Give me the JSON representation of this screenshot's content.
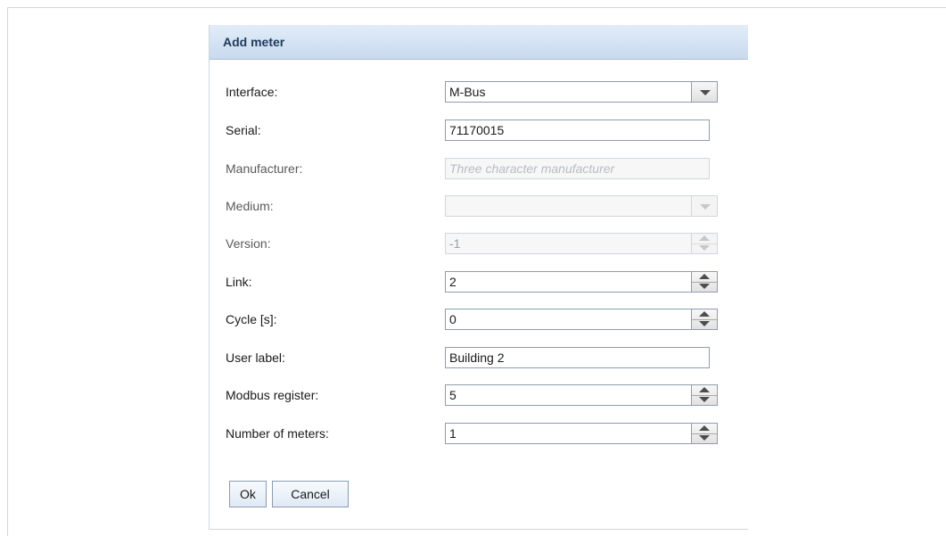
{
  "dialog": {
    "title": "Add meter",
    "fields": {
      "interface": {
        "label": "Interface:",
        "value": "M-Bus"
      },
      "serial": {
        "label": "Serial:",
        "value": "71170015"
      },
      "manufacturer": {
        "label": "Manufacturer:",
        "value": "",
        "placeholder": "Three character manufacturer"
      },
      "medium": {
        "label": "Medium:",
        "value": ""
      },
      "version": {
        "label": "Version:",
        "value": "-1"
      },
      "link": {
        "label": "Link:",
        "value": "2"
      },
      "cycle": {
        "label": "Cycle [s]:",
        "value": "0"
      },
      "user_label": {
        "label": "User label:",
        "value": "Building 2"
      },
      "modbus_register": {
        "label": "Modbus register:",
        "value": "5"
      },
      "number_of_meters": {
        "label": "Number of meters:",
        "value": "1"
      }
    },
    "buttons": {
      "ok": "Ok",
      "cancel": "Cancel"
    }
  },
  "icons": {
    "dropdown": "chevron-down-icon",
    "spin_up": "spin-up-icon",
    "spin_down": "spin-down-icon"
  },
  "colors": {
    "header_bg": "#d3e2f3",
    "header_text": "#1f3a5c",
    "border": "#8e9db0",
    "disabled_text": "#9aa0a6"
  }
}
